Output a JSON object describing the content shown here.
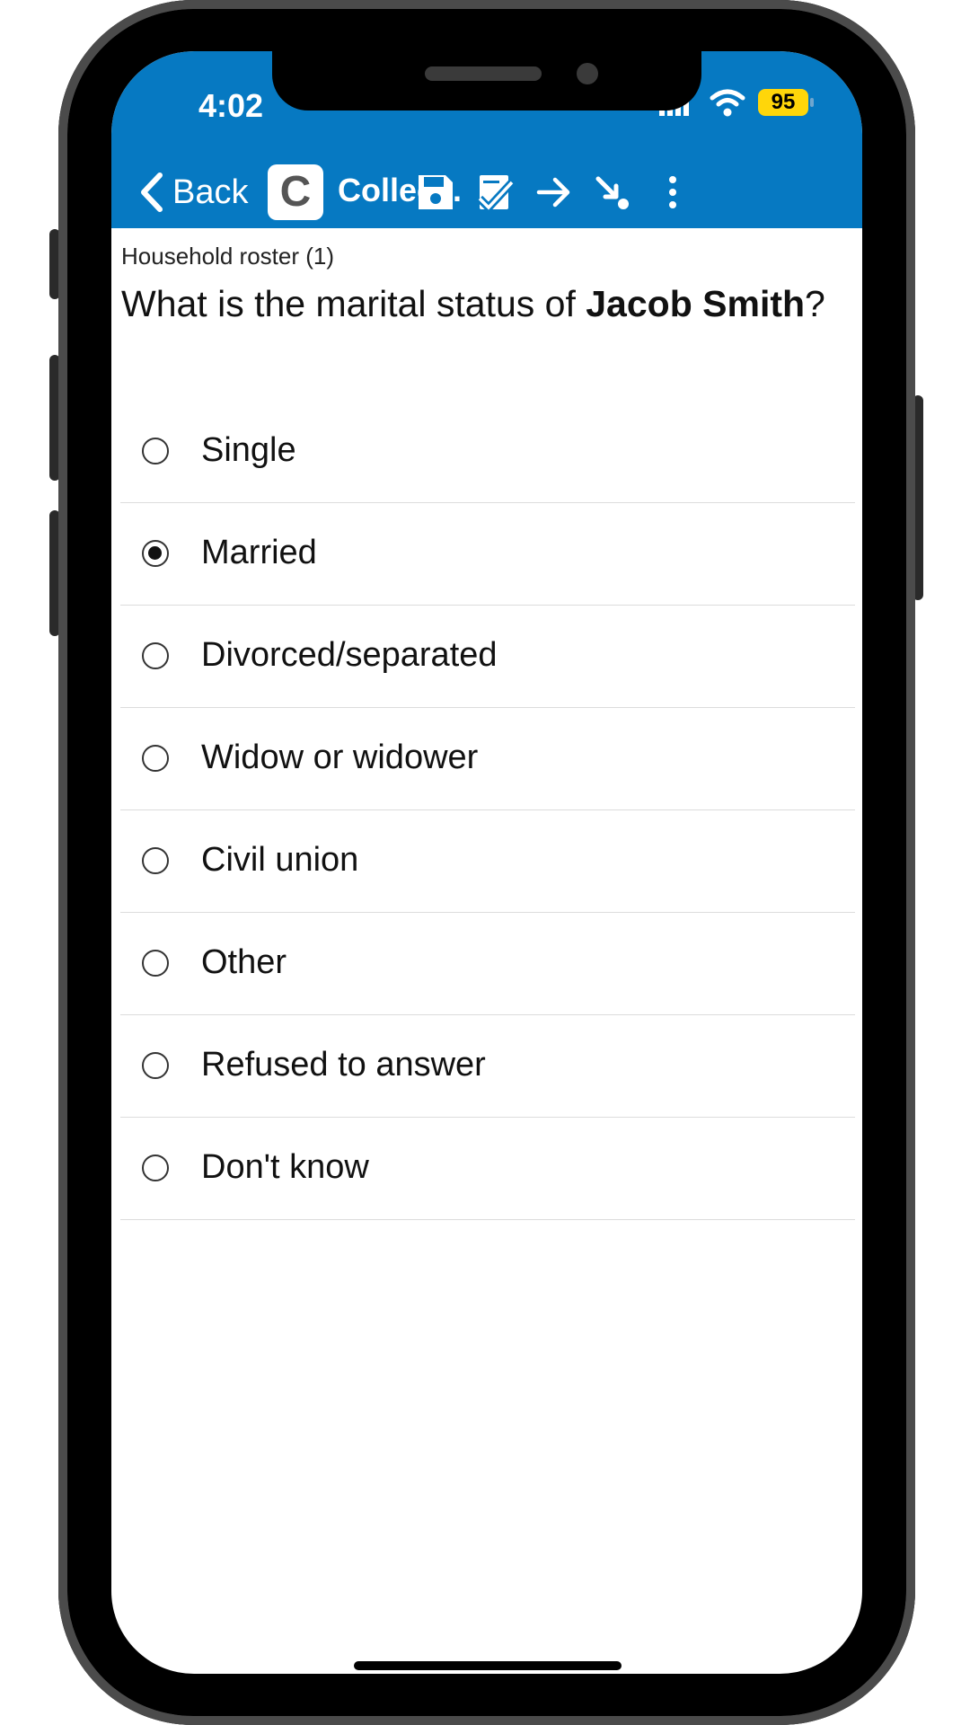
{
  "status_bar": {
    "time": "4:02",
    "battery": "95"
  },
  "toolbar": {
    "back_label": "Back",
    "app_badge": "C",
    "title": "Collec...",
    "icons": [
      "save-icon",
      "check-document-icon",
      "arrow-right-icon",
      "jump-end-icon",
      "more-vert-icon"
    ]
  },
  "question": {
    "section": "Household roster (1)",
    "text_prefix": "What is the marital status of ",
    "person": "Jacob Smith",
    "text_suffix": "?"
  },
  "options": [
    {
      "label": "Single",
      "selected": false
    },
    {
      "label": "Married",
      "selected": true
    },
    {
      "label": "Divorced/separated",
      "selected": false
    },
    {
      "label": "Widow or widower",
      "selected": false
    },
    {
      "label": "Civil union",
      "selected": false
    },
    {
      "label": "Other",
      "selected": false
    },
    {
      "label": "Refused to answer",
      "selected": false
    },
    {
      "label": "Don't know",
      "selected": false
    }
  ],
  "colors": {
    "accent": "#0679c2",
    "battery": "#ffd60a"
  }
}
